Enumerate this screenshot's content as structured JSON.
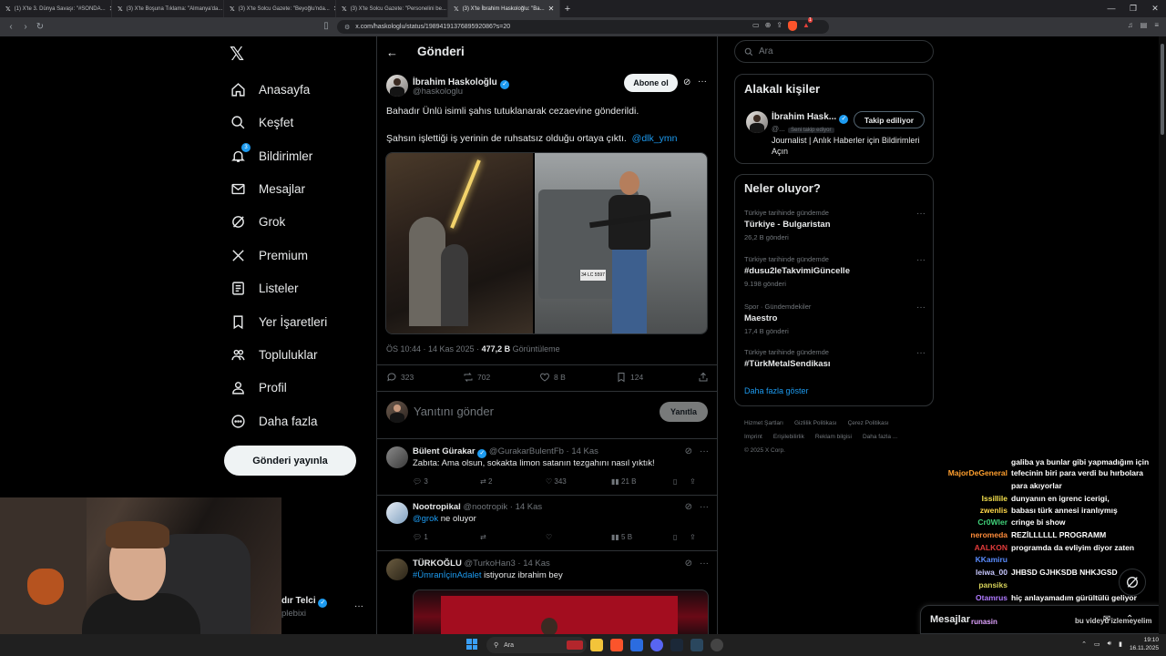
{
  "browser": {
    "tabs": [
      {
        "title": "(1) X'te 3. Dünya Savaşı: \"#SONDA...",
        "active": false
      },
      {
        "title": "(3) X'te Boşuna Tıklama: \"Almanya'da...",
        "active": false
      },
      {
        "title": "(3) X'te Solcu Gazete: \"Beyoğlu'nda...",
        "active": false
      },
      {
        "title": "(3) X'te Solcu Gazete: \"Personelini be...",
        "active": false
      },
      {
        "title": "(3) X'te İbrahim Haskoloğlu: \"Ba...",
        "active": true
      }
    ],
    "url": "x.com/haskologlu/status/1989419137689592086?s=20",
    "brave_badge": "1"
  },
  "nav": {
    "items": [
      {
        "label": "Anasayfa",
        "icon": "home-icon"
      },
      {
        "label": "Keşfet",
        "icon": "search-icon"
      },
      {
        "label": "Bildirimler",
        "icon": "bell-icon",
        "badge": "3"
      },
      {
        "label": "Mesajlar",
        "icon": "mail-icon"
      },
      {
        "label": "Grok",
        "icon": "grok-icon"
      },
      {
        "label": "Premium",
        "icon": "x-icon"
      },
      {
        "label": "Listeler",
        "icon": "list-icon"
      },
      {
        "label": "Yer İşaretleri",
        "icon": "bookmark-icon"
      },
      {
        "label": "Topluluklar",
        "icon": "people-icon"
      },
      {
        "label": "Profil",
        "icon": "user-icon"
      },
      {
        "label": "Daha fazla",
        "icon": "more-circle-icon"
      }
    ],
    "post_button": "Gönderi yayınla",
    "account_name": "dır Telci",
    "account_handle": "plebixi"
  },
  "main": {
    "header_title": "Gönderi",
    "tweet": {
      "author": "İbrahim Haskoloğlu",
      "handle": "@haskologlu",
      "follow_label": "Abone ol",
      "line1": "Bahadır Ünlü isimli şahıs tutuklanarak cezaevine gönderildi.",
      "line2": "Şahsın işlettiği iş yerinin de ruhsatsız olduğu ortaya çıktı.",
      "mention": "@dlk_ymn",
      "plate_text": "34 LC 5597",
      "time": "ÖS 10:44 · 14 Kas 2025 · ",
      "views": "477,2 B",
      "views_label": "Görüntüleme",
      "replies": "323",
      "retweets": "702",
      "likes": "8 B",
      "bookmarks": "124"
    },
    "reply_placeholder": "Yanıtını gönder",
    "reply_button": "Yanıtla",
    "replies": [
      {
        "name": "Bülent Gürakar",
        "verified": true,
        "handle": "@GurakarBulentFb · 14 Kas",
        "text": "Zabıta: Ama olsun, sokakta limon satanın tezgahını nasıl yıktık!",
        "mention": "",
        "r": "3",
        "rt": "2",
        "l": "343",
        "v": "21 B"
      },
      {
        "name": "Nootropikal",
        "verified": false,
        "handle": "@nootropik · 14 Kas",
        "text": "ne oluyor",
        "mention": "@grok",
        "r": "1",
        "rt": "",
        "l": "",
        "v": "5 B"
      },
      {
        "name": "TÜRKOĞLU",
        "verified": false,
        "handle": "@TurkoHan3 · 14 Kas",
        "text": "istiyoruz ibrahim bey",
        "mention": "#ÜmranİçinAdalet",
        "r": "",
        "rt": "",
        "l": "",
        "v": ""
      }
    ]
  },
  "right": {
    "search_placeholder": "Ara",
    "related_title": "Alakalı kişiler",
    "related": {
      "name": "İbrahim Hask...",
      "handle": "@...",
      "follows_you": "Seni takip ediyor",
      "button": "Takip ediliyor",
      "bio": "Journalist | Anlık Haberler için Bildirimleri Açın"
    },
    "trends_title": "Neler oluyor?",
    "trends": [
      {
        "context": "Türkiye tarihinde gündemde",
        "title": "Türkiye - Bulgaristan",
        "count": "26,2 B gönderi"
      },
      {
        "context": "Türkiye tarihinde gündemde",
        "title": "#dusu2leTakvimiGüncelle",
        "count": "9.198 gönderi"
      },
      {
        "context": "Spor · Gündemdekiler",
        "title": "Maestro",
        "count": "17,4 B gönderi"
      },
      {
        "context": "Türkiye tarihinde gündemde",
        "title": "#TürkMetalSendikası",
        "count": ""
      }
    ],
    "show_more": "Daha fazla göster",
    "footer": [
      "Hizmet Şartları",
      "Gizlilik Politikası",
      "Çerez Politikası",
      "Imprint",
      "Erişilebilirlik",
      "Reklam bilgisi",
      "Daha fazla ...",
      "© 2025 X Corp."
    ]
  },
  "chat": [
    {
      "user": "",
      "msg": "galiba ya bunlar gibi yapmadığım için",
      "color": "#ffffff"
    },
    {
      "user": "MajorDeGeneral",
      "msg": "tefecinin biri para verdi bu hırbolara",
      "color": "#ff9f2e"
    },
    {
      "user": "",
      "msg": "para akıyorlar",
      "color": "#ffffff"
    },
    {
      "user": "Issillile",
      "msg": "dunyanın en igrenc icerigi,",
      "color": "#f4e04d"
    },
    {
      "user": "zwenlis",
      "msg": "babası türk annesi iranlıymış",
      "color": "#ffd84a"
    },
    {
      "user": "Cr0Wler",
      "msg": "cringe bi show",
      "color": "#40d27a"
    },
    {
      "user": "neromeda",
      "msg": "REZİLLLLLL PROGRAMM",
      "color": "#ff8c3a"
    },
    {
      "user": "AALKON",
      "msg": "programda da evliyim diyor zaten",
      "color": "#e33b3b"
    },
    {
      "user": "KKamiru",
      "msg": "",
      "color": "#5a8cff"
    },
    {
      "user": "leiwa_00",
      "msg": "JHBSD GJHKSDB NHKJGSD",
      "color": "#c8c8ff"
    },
    {
      "user": "pansiks",
      "msg": "",
      "color": "#d7d25a"
    },
    {
      "user": "Otamrus",
      "msg": "hiç anlayamadım gürültülü geliyor",
      "color": "#b07aff"
    },
    {
      "user": "",
      "msg": "bana",
      "color": "#ffffff"
    },
    {
      "user": "runasin",
      "msg": "",
      "color": "#e0a3ff"
    }
  ],
  "chat_tail": "bu videyu izlemeyelim",
  "messages_dock": "Mesajlar",
  "taskbar": {
    "search": "Ara",
    "time": "19:10",
    "date": "16.11.2025"
  }
}
